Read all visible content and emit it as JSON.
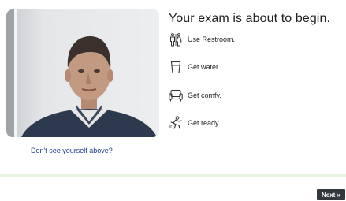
{
  "exam": {
    "title": "Your exam is about to begin."
  },
  "checklist": [
    {
      "label": "Use Restroom.",
      "icon": "restroom-icon"
    },
    {
      "label": "Get water.",
      "icon": "water-glass-icon"
    },
    {
      "label": "Get comfy.",
      "icon": "couch-icon"
    },
    {
      "label": "Get ready.",
      "icon": "ready-icon"
    }
  ],
  "webcam": {
    "help_link": "Don't see yourself above?"
  },
  "footer": {
    "next_label": "Next »"
  },
  "colors": {
    "link": "#1d3d8f",
    "next_button_bg": "#33383e",
    "divider": "#eaf4e2"
  }
}
